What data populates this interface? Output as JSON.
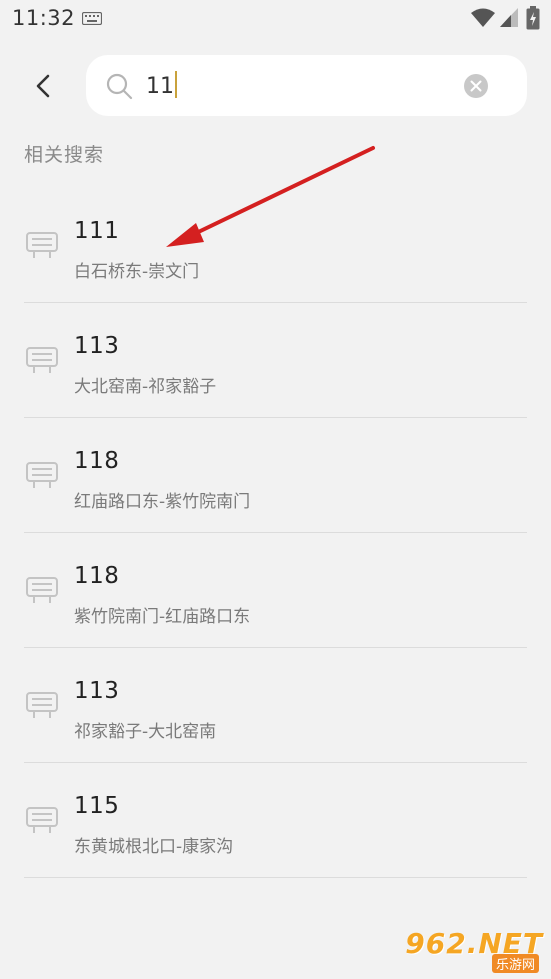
{
  "status_bar": {
    "time": "11:32"
  },
  "search": {
    "query": "11"
  },
  "section": {
    "title": "相关搜索"
  },
  "results": [
    {
      "number": "111",
      "route": "白石桥东-崇文门"
    },
    {
      "number": "113",
      "route": "大北窑南-祁家豁子"
    },
    {
      "number": "118",
      "route": "红庙路口东-紫竹院南门"
    },
    {
      "number": "118",
      "route": "紫竹院南门-红庙路口东"
    },
    {
      "number": "113",
      "route": "祁家豁子-大北窑南"
    },
    {
      "number": "115",
      "route": "东黄城根北口-康家沟"
    }
  ],
  "watermark": {
    "main": "962.NET",
    "sub": "乐游网"
  },
  "colors": {
    "background": "#f2f2f2",
    "card": "#ffffff",
    "caret": "#c9a23c",
    "annotation_arrow": "#d42020"
  },
  "icons": [
    "keyboard-icon",
    "wifi-icon",
    "signal-icon",
    "battery-icon",
    "back-arrow-icon",
    "search-icon",
    "clear-icon",
    "bus-icon"
  ]
}
